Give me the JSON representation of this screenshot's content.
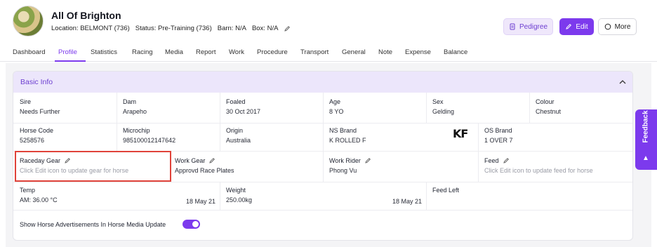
{
  "horse": {
    "name": "All Of Brighton",
    "location_label": "Location:",
    "location": "BELMONT (736)",
    "status_label": "Status:",
    "status": "Pre-Training (736)",
    "barn_label": "Barn:",
    "barn": "N/A",
    "box_label": "Box:",
    "box": "N/A"
  },
  "actions": {
    "pedigree": "Pedigree",
    "edit": "Edit",
    "more": "More"
  },
  "tabs": [
    "Dashboard",
    "Profile",
    "Statistics",
    "Racing",
    "Media",
    "Report",
    "Work",
    "Procedure",
    "Transport",
    "General",
    "Note",
    "Expense",
    "Balance"
  ],
  "active_tab": "Profile",
  "basic_info": {
    "title": "Basic Info",
    "sire": {
      "label": "Sire",
      "value": "Needs Further"
    },
    "dam": {
      "label": "Dam",
      "value": "Arapeho"
    },
    "foaled": {
      "label": "Foaled",
      "value": "30 Oct 2017"
    },
    "age": {
      "label": "Age",
      "value": "8 YO"
    },
    "sex": {
      "label": "Sex",
      "value": "Gelding"
    },
    "colour": {
      "label": "Colour",
      "value": "Chestnut"
    },
    "horse_code": {
      "label": "Horse Code",
      "value": "5258576"
    },
    "microchip": {
      "label": "Microchip",
      "value": "985100012147642"
    },
    "origin": {
      "label": "Origin",
      "value": "Australia"
    },
    "ns_brand": {
      "label": "NS Brand",
      "value": "K ROLLED F",
      "brand_mark": "KF"
    },
    "os_brand": {
      "label": "OS Brand",
      "value": "1 OVER 7"
    },
    "raceday_gear": {
      "label": "Raceday Gear",
      "value": "Click Edit icon to update gear for horse"
    },
    "work_gear": {
      "label": "Work Gear",
      "value": "Approvd Race Plates"
    },
    "work_rider": {
      "label": "Work Rider",
      "value": "Phong Vu"
    },
    "feed": {
      "label": "Feed",
      "value": "Click Edit icon to update feed for horse"
    },
    "temp": {
      "label": "Temp",
      "value": "AM: 36.00 °C",
      "date": "18 May 21"
    },
    "weight": {
      "label": "Weight",
      "value": "250.00kg",
      "date": "18 May 21"
    },
    "feed_left": {
      "label": "Feed Left",
      "value": ""
    },
    "advert_toggle": {
      "label": "Show Horse Advertisements In Horse Media Update",
      "on": true
    }
  },
  "feedback": "Feedback",
  "colors": {
    "accent": "#7c3aed",
    "highlight": "#e0433a",
    "header_bg": "#ece6fb"
  }
}
